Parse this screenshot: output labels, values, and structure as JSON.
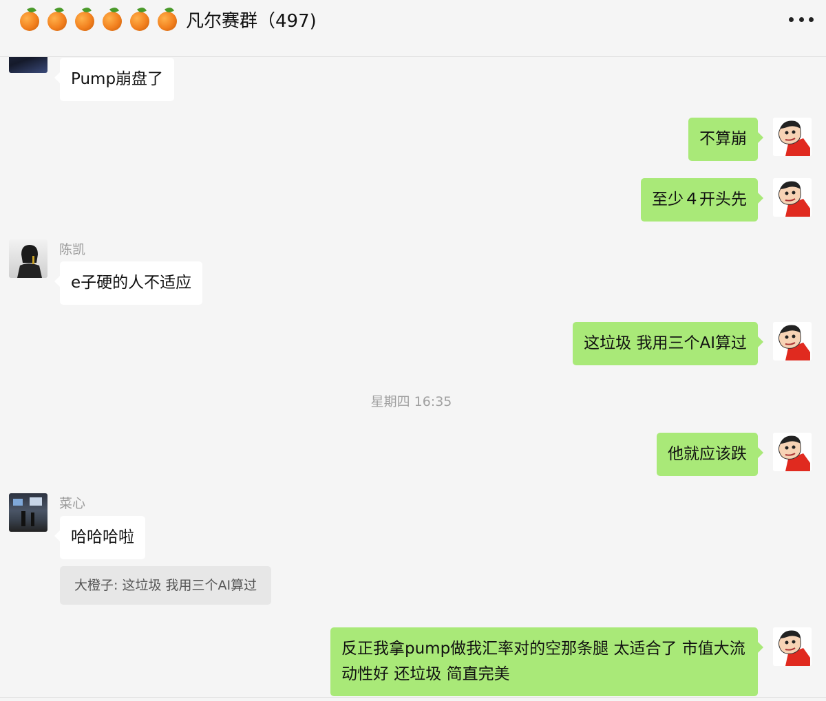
{
  "header": {
    "title": "凡尔赛群（497)",
    "orange_count": 6,
    "more_icon": "more-icon"
  },
  "messages": [
    {
      "side": "in",
      "sender": "",
      "text": "Pump崩盘了"
    },
    {
      "side": "out",
      "text": "不算崩"
    },
    {
      "side": "out",
      "text": "至少４开头先"
    },
    {
      "side": "in",
      "sender": "陈凯",
      "text": "e子硬的人不适应"
    },
    {
      "side": "out",
      "text": "这垃圾 我用三个AI算过"
    },
    {
      "side": "out",
      "text": "他就应该跌"
    },
    {
      "side": "in",
      "sender": "菜心",
      "text": "哈哈哈啦",
      "quote": "大橙子: 这垃圾 我用三个AI算过"
    },
    {
      "side": "out",
      "text": "反正我拿pump做我汇率对的空那条腿 太适合了 市值大流动性好 还垃圾 简直完美"
    }
  ],
  "timestamp": "星期四 16:35",
  "colors": {
    "background": "#f5f5f5",
    "outgoing_bubble": "#a9e978",
    "incoming_bubble": "#ffffff",
    "quote_bg": "#e7e7e7"
  }
}
